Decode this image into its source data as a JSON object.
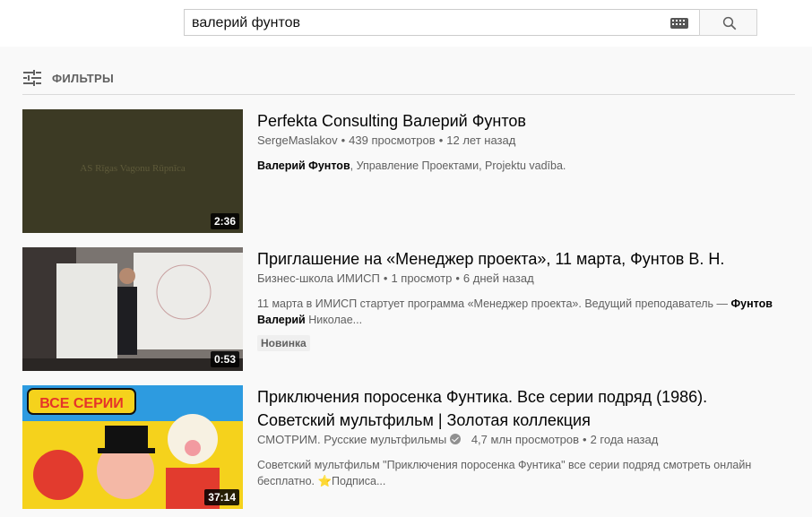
{
  "search": {
    "query": "валерий фунтов"
  },
  "filters": {
    "label": "ФИЛЬТРЫ"
  },
  "results": [
    {
      "title": "Perfekta Consulting Валерий Фунтов",
      "channel": "SergeMaslakov",
      "views": "439 просмотров",
      "age": "12 лет назад",
      "desc_bold": "Валерий Фунтов",
      "desc_rest": ", Управление Проектами, Projektu vadība.",
      "duration": "2:36",
      "thumb_text": "AS Rīgas Vagonu Rūpnīca"
    },
    {
      "title": "Приглашение на «Менеджер проекта», 11 марта, Фунтов В. Н.",
      "channel": "Бизнес-школа ИМИСП",
      "views": "1 просмотр",
      "age": "6 дней назад",
      "desc_pre": "11 марта в ИМИСП стартует программа «Менеджер проекта». Ведущий преподаватель — ",
      "desc_bold": "Фунтов Валерий",
      "desc_rest": " Николае...",
      "badge": "Новинка",
      "duration": "0:53"
    },
    {
      "title": "Приключения поросенка Фунтика. Все серии подряд (1986). Советский мультфильм | Золотая коллекция",
      "channel": "СМОТРИМ. Русские мультфильмы",
      "views": "4,7 млн просмотров",
      "age": "2 года назад",
      "desc": "Советский мультфильм \"Приключения поросенка Фунтика\" все серии подряд смотреть онлайн бесплатно. ⭐Подписа...",
      "duration": "37:14",
      "thumb_text": "ВСЕ СЕРИИ"
    }
  ]
}
